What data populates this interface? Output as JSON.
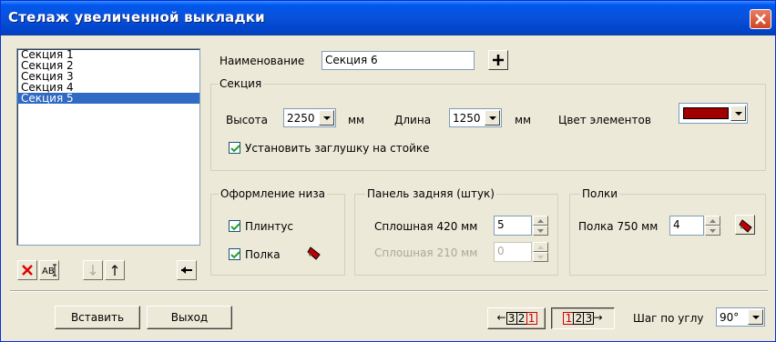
{
  "window": {
    "title": "Стелаж увеличенной выкладки"
  },
  "sections_list": {
    "items": [
      "Секция 1",
      "Секция 2",
      "Секция 3",
      "Секция 4",
      "Секция 5"
    ],
    "selected": "Секция 5"
  },
  "name_row": {
    "label": "Наименование",
    "value": "Секция 6"
  },
  "section_group": {
    "title": "Секция",
    "height_label": "Высота",
    "height_value": "2250",
    "height_unit": "мм",
    "length_label": "Длина",
    "length_value": "1250",
    "length_unit": "мм",
    "color_label": "Цвет элементов",
    "color_value": "#a00000",
    "plug_label": "Установить заглушку на стойке",
    "plug_checked": true
  },
  "bottom_group": {
    "title": "Оформление низа",
    "plinth_label": "Плинтус",
    "plinth_checked": true,
    "shelf_label": "Полка",
    "shelf_checked": true
  },
  "back_panel_group": {
    "title": "Панель задняя (штук)",
    "solid420_label": "Сплошная 420 мм",
    "solid420_value": "5",
    "solid210_label": "Сплошная 210 мм",
    "solid210_value": "0"
  },
  "shelves_group": {
    "title": "Полки",
    "shelf750_label": "Полка 750 мм",
    "shelf750_value": "4"
  },
  "footer": {
    "insert_label": "Вставить",
    "exit_label": "Выход",
    "order_left_digits": [
      "3",
      "2",
      "1"
    ],
    "order_right_digits": [
      "1",
      "2",
      "3"
    ],
    "angle_label": "Шаг по углу",
    "angle_value": "90°"
  },
  "colors": {
    "selection": "#316ac5",
    "title_bar": "#0054e3",
    "accent_red": "#c00000"
  }
}
